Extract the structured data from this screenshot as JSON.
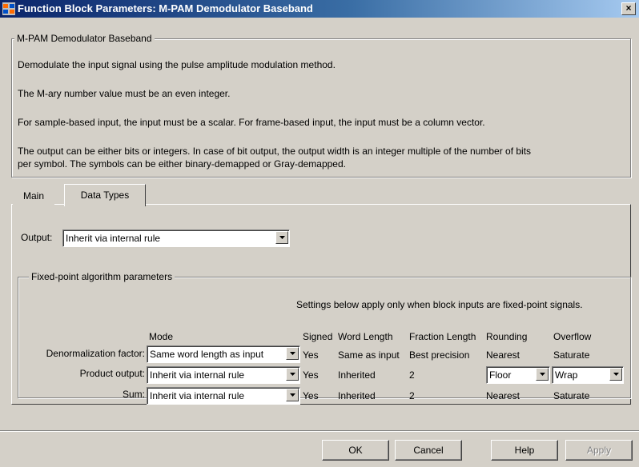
{
  "window": {
    "title": "Function Block Parameters: M-PAM Demodulator Baseband",
    "close_label": "×"
  },
  "block": {
    "group_title": "M-PAM Demodulator Baseband",
    "desc1": "Demodulate the input signal using the pulse amplitude modulation method.",
    "desc2": "The M-ary number value must be an even integer.",
    "desc3": "For sample-based input, the input must be a scalar. For frame-based input, the input must be a column vector.",
    "desc4_line1": "The output can be either bits or integers. In case of bit output, the output width is an integer multiple of the number of bits",
    "desc4_line2": "per symbol. The symbols can be either binary-demapped or Gray-demapped."
  },
  "tabs": [
    {
      "label": "Main",
      "active": false
    },
    {
      "label": "Data Types",
      "active": true
    }
  ],
  "output": {
    "label": "Output:",
    "value": "Inherit via internal rule"
  },
  "fixed_point": {
    "group_title": "Fixed-point algorithm parameters",
    "note": "Settings below apply only when block inputs are fixed-point signals.",
    "headers": {
      "mode": "Mode",
      "signed": "Signed",
      "word_length": "Word Length",
      "fraction_length": "Fraction Length",
      "rounding": "Rounding",
      "overflow": "Overflow"
    },
    "rows": [
      {
        "label": "Denormalization factor:",
        "mode": "Same word length as input",
        "signed": "Yes",
        "word_length": "Same as input",
        "fraction_length": "Best precision",
        "rounding": "Nearest",
        "overflow": "Saturate"
      },
      {
        "label": "Product output:",
        "mode": "Inherit via internal rule",
        "signed": "Yes",
        "word_length": "Inherited",
        "fraction_length": "2",
        "rounding": "Floor",
        "overflow": "Wrap"
      },
      {
        "label": "Sum:",
        "mode": "Inherit via internal rule",
        "signed": "Yes",
        "word_length": "Inherited",
        "fraction_length": "2",
        "rounding": "Nearest",
        "overflow": "Saturate"
      }
    ]
  },
  "buttons": {
    "ok": "OK",
    "cancel": "Cancel",
    "help": "Help",
    "apply": "Apply"
  }
}
